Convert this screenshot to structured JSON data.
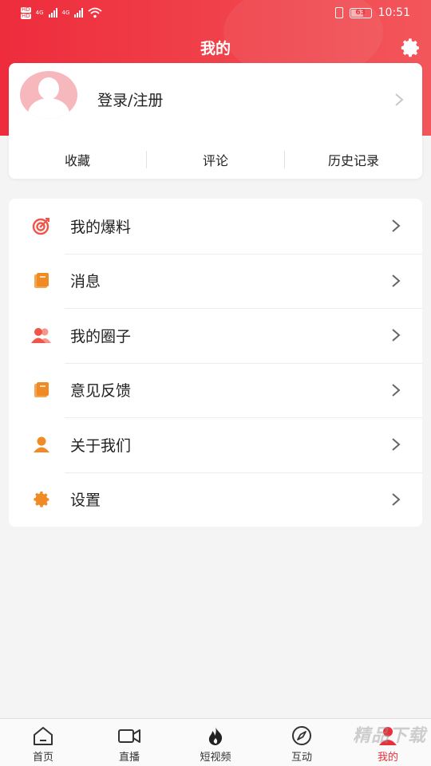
{
  "status_bar": {
    "network_1": "4G",
    "network_2": "4G",
    "battery": "63",
    "time": "10:51"
  },
  "header": {
    "title": "我的"
  },
  "profile": {
    "login_label": "登录/注册",
    "quick_links": [
      {
        "label": "收藏"
      },
      {
        "label": "评论"
      },
      {
        "label": "历史记录"
      }
    ]
  },
  "menu": {
    "items": [
      {
        "label": "我的爆料",
        "icon": "target-icon",
        "color": "#f0554a"
      },
      {
        "label": "消息",
        "icon": "book-icon",
        "color": "#f08a24"
      },
      {
        "label": "我的圈子",
        "icon": "people-icon",
        "color": "#f0554a"
      },
      {
        "label": "意见反馈",
        "icon": "book-icon",
        "color": "#f08a24"
      },
      {
        "label": "关于我们",
        "icon": "person-icon",
        "color": "#f08a24"
      },
      {
        "label": "设置",
        "icon": "gear-icon",
        "color": "#f08a24"
      }
    ]
  },
  "bottom_nav": {
    "items": [
      {
        "label": "首页",
        "icon": "home-icon"
      },
      {
        "label": "直播",
        "icon": "video-camera-icon"
      },
      {
        "label": "短视频",
        "icon": "flame-icon"
      },
      {
        "label": "互动",
        "icon": "compass-icon"
      },
      {
        "label": "我的",
        "icon": "person-icon",
        "active": true
      }
    ]
  },
  "watermark": "精品下载",
  "colors": {
    "brand_red": "#ee2c3c",
    "accent_orange": "#f08a24",
    "background": "#f4f4f4"
  }
}
